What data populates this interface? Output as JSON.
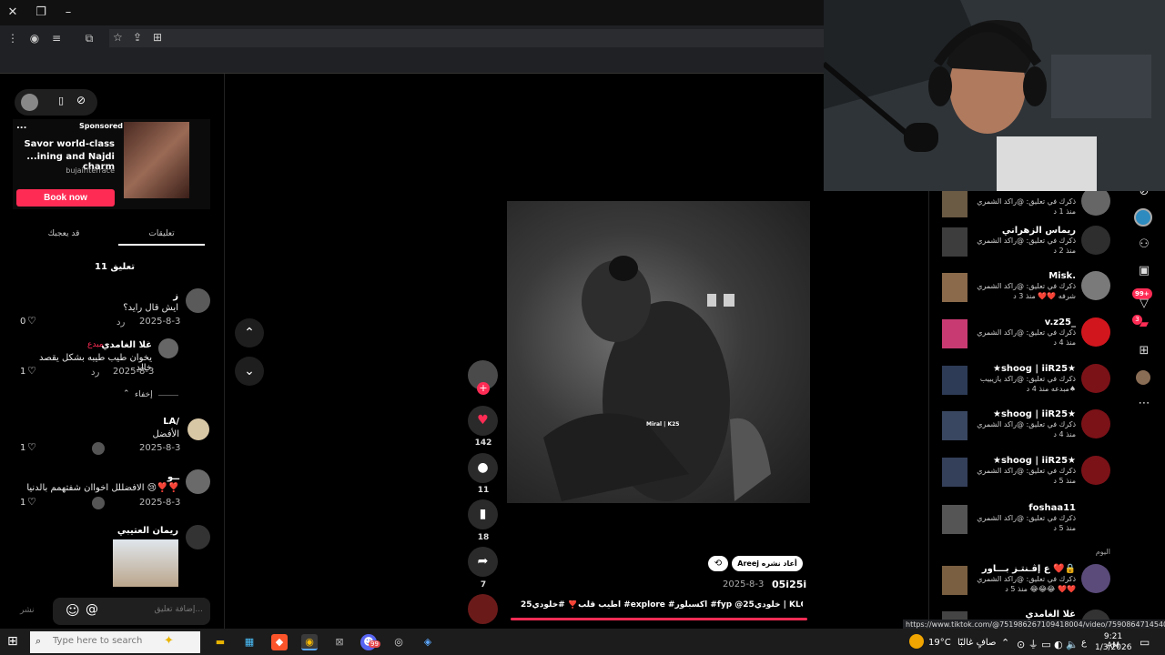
{
  "ad": {
    "sponsored": "Sponsored",
    "more": "...",
    "line1": "Savor world-class",
    "line2": "...ining and Najdi charm",
    "domain": "bujairiterrace",
    "cta": "Book now"
  },
  "tabs": {
    "comments": "تعليقات",
    "liked": "قد يعجبك"
  },
  "comments_count": "11 تعليق",
  "comments": [
    {
      "name": "ز",
      "text": "ايش قال رايد؟",
      "date": "2025-8-3",
      "reply": "رد",
      "likes": "0"
    },
    {
      "name": "غلا الغامدي",
      "badge": "مبدع",
      "text": "يخوان طيب طيبه بشكل يقصد خالد",
      "date": "2025-8-3",
      "reply": "رد",
      "likes": "1"
    },
    {
      "name": "LA/",
      "text": "الأفضل",
      "date": "2025-8-3",
      "reply": "رد",
      "likes": "1"
    },
    {
      "name": "ــو",
      "text": "الافضللل اخواان شفتهمم بالدنيا 😢❣️❣️",
      "date": "2025-8-3",
      "reply": "رد",
      "likes": "1"
    },
    {
      "name": "ريمان العتيبي"
    }
  ],
  "hide_replies": "إخفاء",
  "input": {
    "placeholder": "إضافة تعليق...",
    "post": "نشر",
    "at": "@"
  },
  "video": {
    "watermark": "Miral | K25",
    "repost_by": "Areej أعاد نشره",
    "author": "05i25i",
    "date": "2025-8-3",
    "caption": "اطيب قلب❣️ #خلودي25 #explore #اكسبلور #fyp @خلودي25 | KLOoODE25",
    "likes": "142",
    "comments": "11",
    "saves": "18",
    "shares": "7"
  },
  "notifications": [
    {
      "name": "",
      "text": "ذكرك في تعليق: @راكد الشمري",
      "time": "منذ 1 د"
    },
    {
      "name": "ريماس الزهراني",
      "text": "ذكرك في تعليق: @راكد الشمري",
      "time": "منذ 2 د"
    },
    {
      "name": "Misk.",
      "text": "ذكرك في تعليق: @راكد الشمري شرفه ❤️❤️",
      "time": "منذ 3 د"
    },
    {
      "name": "v.z25_",
      "text": "ذكرك في تعليق: @راكد الشمري",
      "time": "منذ 4 د"
    },
    {
      "name": "★shoog | iiR25★",
      "text": "ذكرك في تعليق: @راكد يازيييب ♠مبدعه",
      "time": "منذ 4 د"
    },
    {
      "name": "★shoog | iiR25★",
      "text": "ذكرك في تعليق: @راكد الشمري",
      "time": "منذ 4 د"
    },
    {
      "name": "★shoog | iiR25★",
      "text": "ذكرك في تعليق: @راكد الشمري",
      "time": "منذ 5 د"
    },
    {
      "name": "foshaa11",
      "text": "ذكرك في تعليق: @راكد الشمري",
      "time": "منذ 5 د"
    },
    {
      "section": "اليوم"
    },
    {
      "name": "ع إڤـنتـز بـــاور ❤️🔒",
      "text": "ذكرك في تعليق: @راكد الشمري ❤️❤️ 😂😂😂",
      "time": "منذ 5 د"
    },
    {
      "name": "غلا الغامدي"
    }
  ],
  "right_nav_badges": {
    "inbox": "99+",
    "messages": "3"
  },
  "url_tooltip": "https://www.tiktok.com/@751986267109418004/video/7590864714540813586",
  "taskbar": {
    "search_placeholder": "Type here to search",
    "weather": "19°C",
    "weather_text": "صافٍ غالبًا",
    "lang": "ع",
    "time": "9:21 AM",
    "date": "1/3/2026",
    "badge": "99"
  },
  "colors": {
    "accent": "#fe2c55",
    "bg": "#000000",
    "panel": "#1f1f1f"
  }
}
